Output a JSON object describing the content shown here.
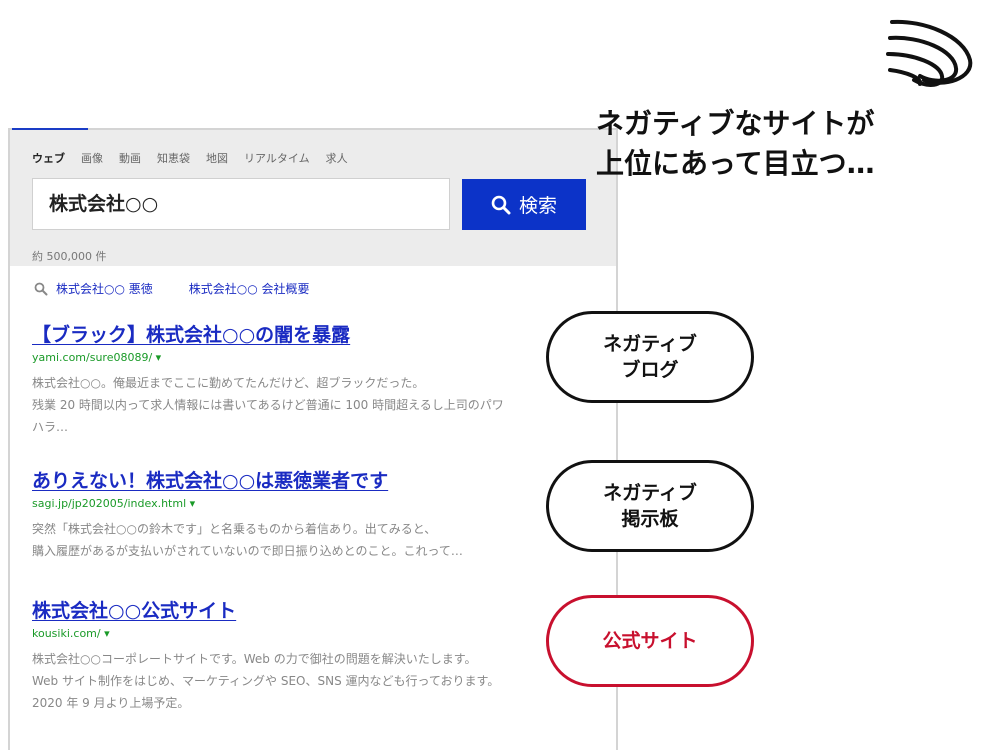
{
  "header": {
    "tabs": [
      "ウェブ",
      "画像",
      "動画",
      "知恵袋",
      "地図",
      "リアルタイム",
      "求人"
    ],
    "active_tab": "ウェブ",
    "search_value": "株式会社○○",
    "search_button_label": "検索",
    "result_count": "約 500,000 件"
  },
  "related_searches": [
    "株式会社○○ 悪徳",
    "株式会社○○ 会社概要"
  ],
  "results": [
    {
      "title": "【ブラック】株式会社○○の闇を暴露",
      "url": "yami.com/sure08089/ ▾",
      "snippet": [
        "株式会社○○。俺最近までここに勤めてたんだけど、超ブラックだった。",
        "残業 20 時間以内って求人情報には書いてあるけど普通に 100 時間超えるし上司のパワ",
        "ハラ…"
      ]
    },
    {
      "title": "ありえない！株式会社○○は悪徳業者です",
      "url": "sagi.jp/jp202005/index.html ▾",
      "snippet": [
        "突然「株式会社○○の鈴木です」と名乗るものから着信あり。出てみると、",
        "購入履歴があるが支払いがされていないので即日振り込めとのこと。これって…"
      ]
    },
    {
      "title": "株式会社○○公式サイト",
      "url": "kousiki.com/ ▾",
      "snippet": [
        "株式会社○○コーポレートサイトです。Web の力で御社の問題を解決いたします。",
        "Web サイト制作をはじめ、マーケティングや SEO、SNS 運内なども行っております。",
        "2020 年 9 月より上場予定。"
      ]
    }
  ],
  "callout": {
    "line1": "ネガティブなサイトが",
    "line2": "上位にあって目立つ…"
  },
  "labels": [
    {
      "line1": "ネガティブ",
      "line2": "ブログ"
    },
    {
      "line1": "ネガティブ",
      "line2": "掲示板"
    },
    {
      "line1": "公式サイト",
      "line2": ""
    }
  ],
  "colors": {
    "link": "#1a2bc2",
    "url": "#1a9a28",
    "search_button": "#0c33c8",
    "official_label": "#c8102e"
  },
  "icons": {
    "search_button": "magnifier-icon",
    "related": "magnifier-icon",
    "decoration": "scribble-icon"
  }
}
